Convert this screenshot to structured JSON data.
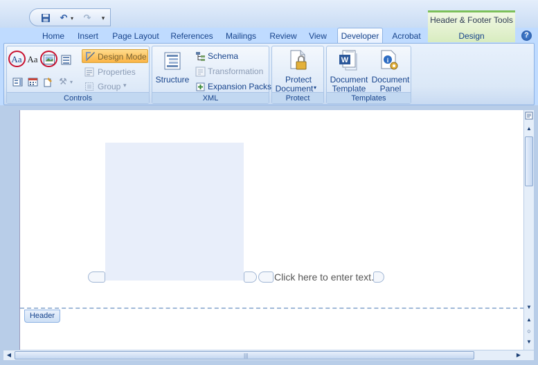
{
  "quick_access": {
    "save_icon": "save-icon",
    "undo_icon": "undo-icon",
    "redo_icon": "redo-icon",
    "customize_icon": "customize-icon"
  },
  "contextual": {
    "title": "Header & Footer Tools",
    "tab_label": "Design"
  },
  "tabs": [
    {
      "label": "Home"
    },
    {
      "label": "Insert"
    },
    {
      "label": "Page Layout"
    },
    {
      "label": "References"
    },
    {
      "label": "Mailings"
    },
    {
      "label": "Review"
    },
    {
      "label": "View"
    },
    {
      "label": "Developer",
      "active": true
    },
    {
      "label": "Acrobat"
    }
  ],
  "help_label": "?",
  "ribbon": {
    "controls": {
      "label": "Controls",
      "design_mode": "Design Mode",
      "properties": "Properties",
      "group": "Group",
      "group_dropdown": "▾",
      "rich_text_glyph": "Aa",
      "plain_text_glyph": "Aa"
    },
    "xml": {
      "label": "XML",
      "structure": "Structure",
      "schema": "Schema",
      "transformation": "Transformation",
      "expansion_packs": "Expansion Packs"
    },
    "protect": {
      "label": "Protect",
      "protect_line1": "Protect",
      "protect_line2": "Document",
      "protect_dropdown": "▾"
    },
    "templates": {
      "label": "Templates",
      "doc_template_line1": "Document",
      "doc_template_line2": "Template",
      "doc_panel_line1": "Document",
      "doc_panel_line2": "Panel"
    }
  },
  "document": {
    "content_control_text": "Click here to enter text.",
    "header_label": "Header"
  },
  "colors": {
    "highlight_ring": "#c8102e",
    "design_mode_active": "#fbb445"
  }
}
